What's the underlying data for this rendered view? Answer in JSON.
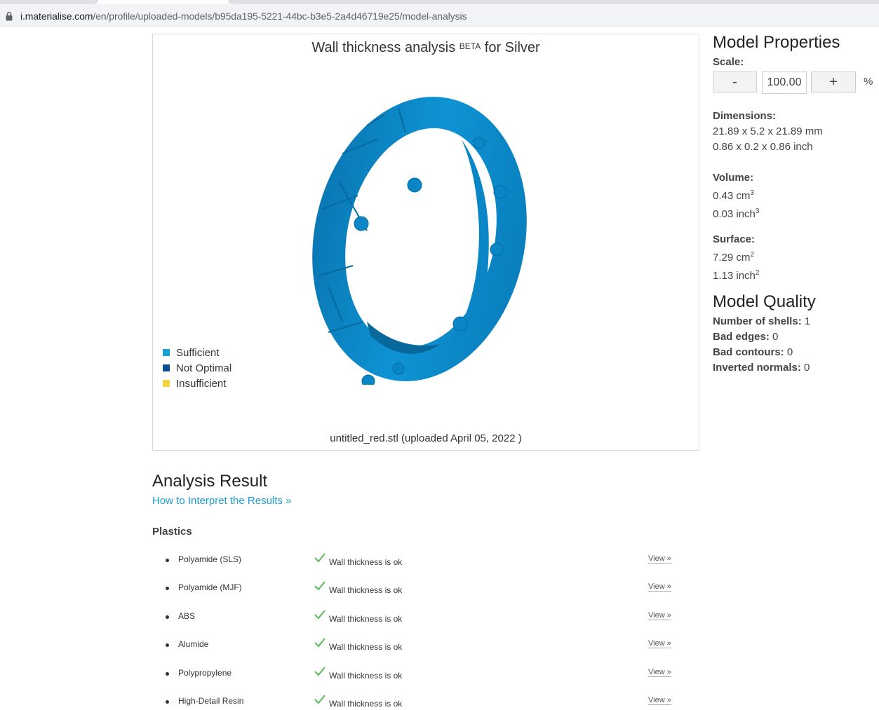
{
  "browser": {
    "url_host": "i.materialise.com",
    "url_path": "/en/profile/uploaded-models/b95da195-5221-44bc-b3e5-2a4d46719e25/model-analysis"
  },
  "viewer": {
    "title_main": "Wall thickness analysis",
    "title_sup": "BETA",
    "title_material": "for Silver",
    "filename": "untitled_red.stl (uploaded April 05, 2022 )",
    "legend": [
      {
        "label": "Sufficient",
        "color": "#1aa1d4"
      },
      {
        "label": "Not Optimal",
        "color": "#0b4f91"
      },
      {
        "label": "Insufficient",
        "color": "#f5d442"
      }
    ],
    "model_color": "#0b8ac9"
  },
  "properties": {
    "title": "Model Properties",
    "scale_label": "Scale:",
    "minus": "-",
    "scale_value": "100.00",
    "plus": "+",
    "percent": "%",
    "dimensions_label": "Dimensions:",
    "dimensions_mm": "21.89 x 5.2 x 21.89 mm",
    "dimensions_inch": "0.86 x 0.2 x 0.86 inch",
    "volume_label": "Volume:",
    "volume_cm": "0.43 cm",
    "volume_inch": "0.03 inch",
    "surface_label": "Surface:",
    "surface_cm": "7.29 cm",
    "surface_inch": "1.13 inch",
    "exp3": "3",
    "exp2": "2"
  },
  "quality": {
    "title": "Model Quality",
    "shells_label": "Number of shells:",
    "shells": "1",
    "bad_edges_label": "Bad edges:",
    "bad_edges": "0",
    "bad_contours_label": "Bad contours:",
    "bad_contours": "0",
    "inverted_label": "Inverted normals:",
    "inverted": "0"
  },
  "analysis": {
    "title": "Analysis Result",
    "howto": "How to Interpret the Results »",
    "category": "Plastics",
    "check_color": "#5cb85c",
    "rows": [
      {
        "material": "Polyamide (SLS)",
        "status": "Wall thickness is ok",
        "view": "View »"
      },
      {
        "material": "Polyamide (MJF)",
        "status": "Wall thickness is ok",
        "view": "View »"
      },
      {
        "material": "ABS",
        "status": "Wall thickness is ok",
        "view": "View »"
      },
      {
        "material": "Alumide",
        "status": "Wall thickness is ok",
        "view": "View »"
      },
      {
        "material": "Polypropylene",
        "status": "Wall thickness is ok",
        "view": "View »"
      },
      {
        "material": "High-Detail Resin",
        "status": "Wall thickness is ok",
        "view": "View »"
      }
    ]
  }
}
